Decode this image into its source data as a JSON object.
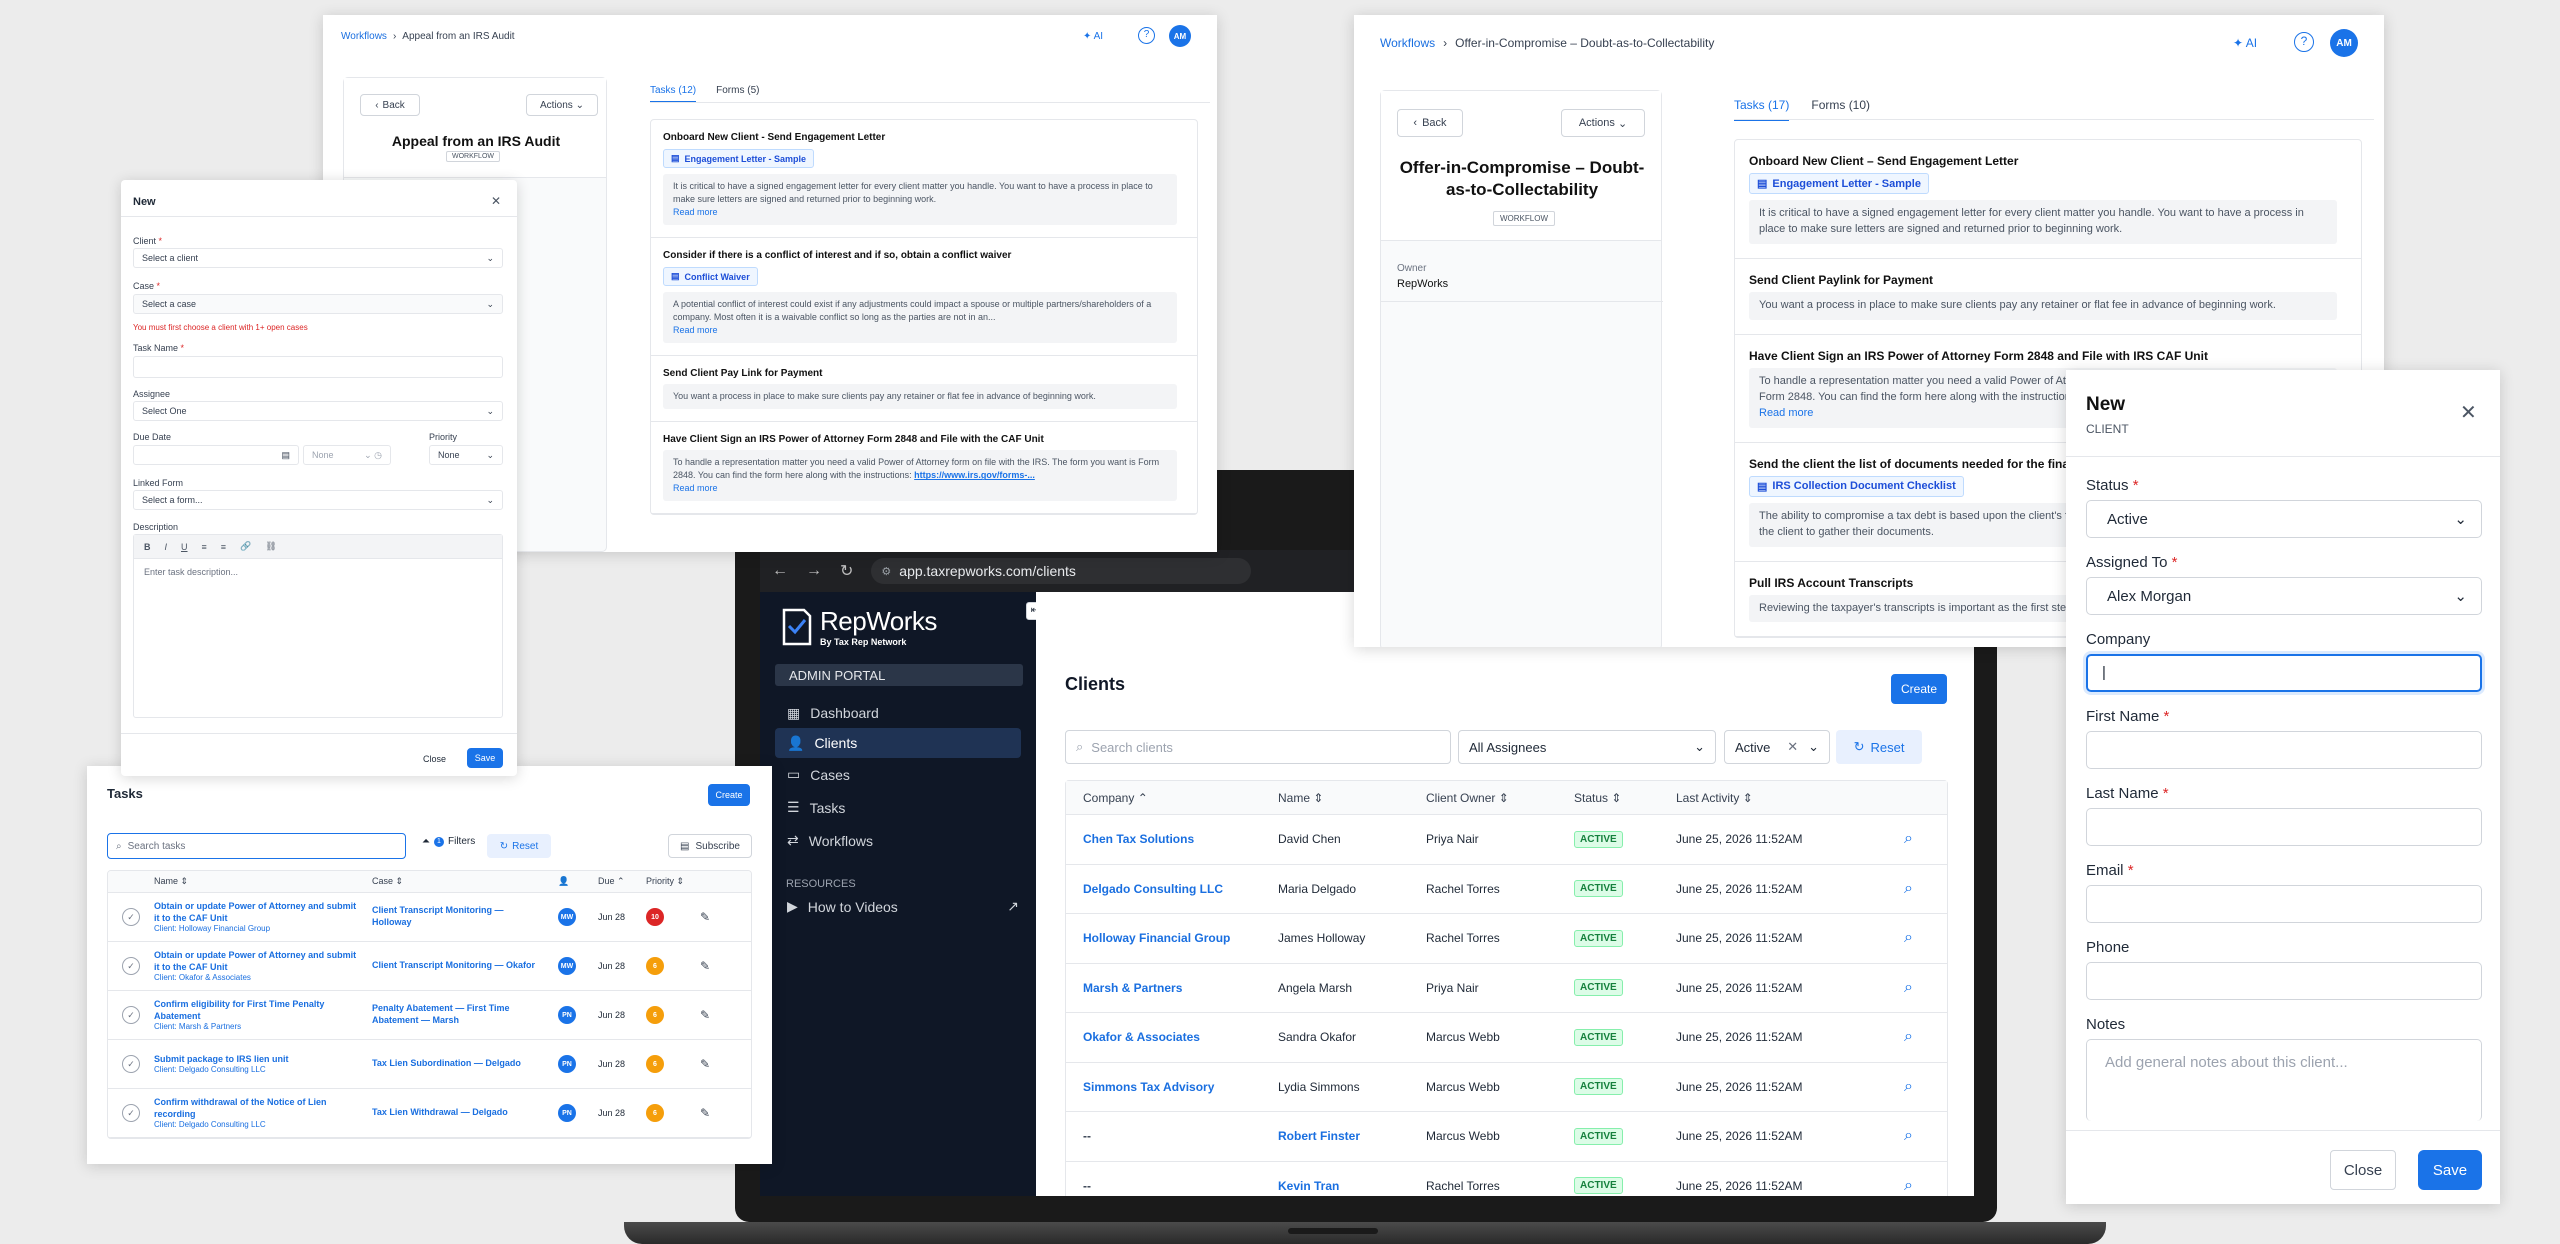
{
  "w1": {
    "crumb_root": "Workflows",
    "crumb_current": "Appeal from an IRS Audit",
    "ai": "AI",
    "avatar": "AM",
    "back": "Back",
    "actions": "Actions",
    "title": "Appeal from an IRS Audit",
    "badge": "WORKFLOW",
    "tabs": [
      "Tasks (12)",
      "Forms (5)"
    ],
    "tasks": [
      {
        "title": "Onboard New Client - Send Engagement Letter",
        "form": "Engagement Letter - Sample",
        "desc": "It is critical to have a signed engagement letter for every client matter you handle. You want to have a process in place to make sure letters are signed and returned prior to beginning work.",
        "more": "Read more"
      },
      {
        "title": "Consider if there is a conflict of interest and if so, obtain a conflict waiver",
        "form": "Conflict Waiver",
        "desc": "A potential conflict of interest could exist if any adjustments could impact a spouse or multiple partners/shareholders of a company. Most often it is a waivable conflict so long as the parties are not in an...",
        "more": "Read more"
      },
      {
        "title": "Send Client Pay Link for Payment",
        "desc": "You want a process in place to make sure clients pay any retainer or flat fee in advance of beginning work."
      },
      {
        "title": "Have Client Sign an IRS Power of Attorney Form 2848 and File with the CAF Unit",
        "desc": "To handle a representation matter you need a valid Power of Attorney form on file with the IRS. The form you want is Form 2848. You can find the form here along with the instructions:",
        "link": "https://www.irs.gov/forms-...",
        "more": "Read more"
      }
    ]
  },
  "newtask": {
    "title": "New",
    "client_label": "Client",
    "client_ph": "Select a client",
    "case_label": "Case",
    "case_ph": "Select a case",
    "case_err": "You must first choose a client with 1+ open cases",
    "taskname_label": "Task Name",
    "assignee_label": "Assignee",
    "assignee_ph": "Select One",
    "due_label": "Due Date",
    "time_ph": "None",
    "priority_label": "Priority",
    "priority_val": "None",
    "linked_label": "Linked Form",
    "linked_ph": "Select a form...",
    "desc_label": "Description",
    "desc_ph": "Enter task description...",
    "tb": [
      "B",
      "I",
      "U",
      "≡",
      "≡",
      "🔗",
      "⛓"
    ],
    "close": "Close",
    "save": "Save"
  },
  "tasksp": {
    "title": "Tasks",
    "create": "Create",
    "search_ph": "Search tasks",
    "filters": "Filters",
    "filters_count": "1",
    "reset": "Reset",
    "subscribe": "Subscribe",
    "cols": [
      "Name",
      "Case",
      "Due",
      "Priority"
    ],
    "rows": [
      {
        "name": "Obtain or update Power of Attorney and submit it to the CAF Unit",
        "client": "Client: Holloway Financial Group",
        "case": "Client Transcript Monitoring — Holloway",
        "av": "MW",
        "due": "Jun 28",
        "pr": "10",
        "pc": "#dc2626"
      },
      {
        "name": "Obtain or update Power of Attorney and submit it to the CAF Unit",
        "client": "Client: Okafor & Associates",
        "case": "Client Transcript Monitoring — Okafor",
        "av": "MW",
        "due": "Jun 28",
        "pr": "6",
        "pc": "#f59e0b"
      },
      {
        "name": "Confirm eligibility for First Time Penalty Abatement",
        "client": "Client: Marsh & Partners",
        "case": "Penalty Abatement — First Time Abatement — Marsh",
        "av": "PN",
        "due": "Jun 28",
        "pr": "6",
        "pc": "#f59e0b"
      },
      {
        "name": "Submit package to IRS lien unit",
        "client": "Client: Delgado Consulting LLC",
        "case": "Tax Lien Subordination — Delgado",
        "av": "PN",
        "due": "Jun 28",
        "pr": "6",
        "pc": "#f59e0b"
      },
      {
        "name": "Confirm withdrawal of the Notice of Lien recording",
        "client": "Client: Delgado Consulting LLC",
        "case": "Tax Lien Withdrawal — Delgado",
        "av": "PN",
        "due": "Jun 28",
        "pr": "6",
        "pc": "#f59e0b"
      }
    ]
  },
  "w2": {
    "crumb_root": "Workflows",
    "crumb_current": "Offer-in-Compromise – Doubt-as-to-Collectability",
    "ai": "AI",
    "avatar": "AM",
    "back": "Back",
    "actions": "Actions",
    "title": "Offer-in-Compromise – Doubt-as-to-Collectability",
    "badge": "WORKFLOW",
    "owner_label": "Owner",
    "owner": "RepWorks",
    "tabs": [
      "Tasks (17)",
      "Forms (10)"
    ],
    "tasks": [
      {
        "title": "Onboard New Client – Send Engagement Letter",
        "form": "Engagement Letter - Sample",
        "desc": "It is critical to have a signed engagement letter for every client matter you handle. You want to have a process in place to make sure letters are signed and returned prior to beginning work."
      },
      {
        "title": "Send Client Paylink for Payment",
        "desc": "You want a process in place to make sure clients pay any retainer or flat fee in advance of beginning work."
      },
      {
        "title": "Have Client Sign an IRS Power of Attorney Form 2848 and File with IRS CAF Unit",
        "desc": "To handle a representation matter you need a valid Power of Attorney form on file with the IRS. The form you want is Form 2848. You can find the form here along with the instructions.",
        "more": "Read more"
      },
      {
        "title": "Send the client the list of documents needed for the financial statement",
        "form": "IRS Collection Document Checklist",
        "desc": "The ability to compromise a tax debt is based upon the client's financial situation. Attached is a sample checklist for the client to gather their documents."
      },
      {
        "title": "Pull IRS Account Transcripts",
        "desc": "Reviewing the taxpayer's transcripts is important as the first step."
      }
    ]
  },
  "browser": {
    "url": "app.taxrepworks.com/clients"
  },
  "app": {
    "logo_name": "RepWorks",
    "logo_sub": "By Tax Rep Network",
    "portal": "ADMIN PORTAL",
    "nav": [
      "Dashboard",
      "Clients",
      "Cases",
      "Tasks",
      "Workflows"
    ],
    "resources": "RESOURCES",
    "howto": "How to Videos",
    "page_title": "Clients",
    "create": "Create",
    "search_ph": "Search clients",
    "assignees": "All Assignees",
    "status": "Active",
    "reset": "Reset",
    "cols": [
      "Company",
      "Name",
      "Client Owner",
      "Status",
      "Last Activity"
    ],
    "rows": [
      {
        "company": "Chen Tax Solutions",
        "name": "David Chen",
        "owner": "Priya Nair",
        "status": "ACTIVE",
        "last": "June 25, 2026 11:52AM"
      },
      {
        "company": "Delgado Consulting LLC",
        "name": "Maria Delgado",
        "owner": "Rachel Torres",
        "status": "ACTIVE",
        "last": "June 25, 2026 11:52AM"
      },
      {
        "company": "Holloway Financial Group",
        "name": "James Holloway",
        "owner": "Rachel Torres",
        "status": "ACTIVE",
        "last": "June 25, 2026 11:52AM"
      },
      {
        "company": "Marsh & Partners",
        "name": "Angela Marsh",
        "owner": "Priya Nair",
        "status": "ACTIVE",
        "last": "June 25, 2026 11:52AM"
      },
      {
        "company": "Okafor & Associates",
        "name": "Sandra Okafor",
        "owner": "Marcus Webb",
        "status": "ACTIVE",
        "last": "June 25, 2026 11:52AM"
      },
      {
        "company": "Simmons Tax Advisory",
        "name": "Lydia Simmons",
        "owner": "Marcus Webb",
        "status": "ACTIVE",
        "last": "June 25, 2026 11:52AM"
      },
      {
        "company": "--",
        "name": "Robert Finster",
        "owner": "Marcus Webb",
        "status": "ACTIVE",
        "last": "June 25, 2026 11:52AM"
      },
      {
        "company": "--",
        "name": "Kevin Tran",
        "owner": "Rachel Torres",
        "status": "ACTIVE",
        "last": "June 25, 2026 11:52AM"
      }
    ]
  },
  "newclient": {
    "title": "New",
    "subtitle": "CLIENT",
    "status_label": "Status",
    "status_val": "Active",
    "assigned_label": "Assigned To",
    "assigned_val": "Alex Morgan",
    "company_label": "Company",
    "first_label": "First Name",
    "last_label": "Last Name",
    "email_label": "Email",
    "phone_label": "Phone",
    "notes_label": "Notes",
    "notes_ph": "Add general notes about this client...",
    "close": "Close",
    "save": "Save"
  },
  "colors": {
    "accent": "#1a73e8",
    "sidebar": "#0f1726",
    "active": "#15803d"
  }
}
